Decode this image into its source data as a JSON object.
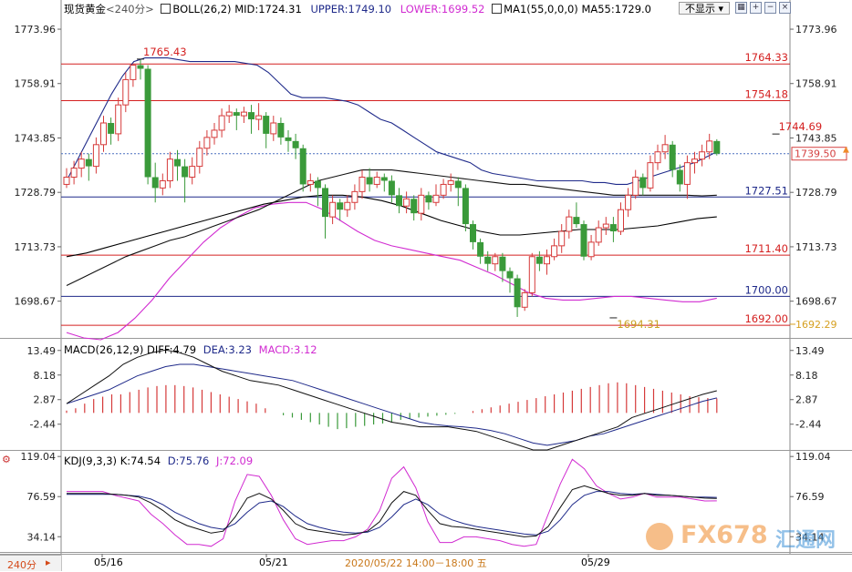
{
  "header": {
    "symbol": "现货黄金",
    "period": "240分",
    "boll": "BOLL(26,2)",
    "mid": "MID:1724.31",
    "upper": "UPPER:1749.10",
    "lower": "LOWER:1699.52",
    "ma": "MA1(55,0,0,0)",
    "ma55": "MA55:1729.0",
    "hide_button": "不显示",
    "tool_icons": [
      "grid-icon",
      "plus-icon",
      "minus-icon",
      "close-icon"
    ]
  },
  "macd_header": {
    "title": "MACD(26,12,9)",
    "diff": "DIFF:4.79",
    "dea": "DEA:3.23",
    "macd": "MACD:3.12"
  },
  "kdj_header": {
    "title": "KDJ(9,3,3)",
    "k": "K:74.54",
    "d": "D:75.76",
    "j": "J:72.09"
  },
  "bottom": {
    "period_label": "240分",
    "x_ticks": [
      "05/16",
      "05/21",
      "05/29"
    ],
    "cursor_time": "2020/05/22 14:00－18:00 五"
  },
  "watermark": {
    "brand": "FX678",
    "cn": "汇通网"
  },
  "colors": {
    "up": "#d63a3a",
    "down": "#3a9a3a",
    "mid": "#000000",
    "upper": "#1f2a8a",
    "lower": "#d12bd1",
    "ma55": "#111111",
    "hline_red": "#d42020",
    "hline_blue": "#1f2a8a",
    "current": "#4a6fbf",
    "price_tag": "#d44040"
  },
  "chart_data": [
    {
      "type": "candlestick",
      "title": "现货黄金 240分",
      "ylim": [
        1688.5,
        1777.5
      ],
      "y_ticks": [
        "1773.96",
        "1758.91",
        "1743.85",
        "1728.79",
        "1713.73",
        "1698.67"
      ],
      "current_price": "1739.50",
      "current_value": 1739.5,
      "lower_price_label": "1692.29",
      "lower_price_value": 1692.29,
      "annotations": [
        {
          "text": "1765.43",
          "index": 10,
          "value": 1765.43,
          "type": "high"
        },
        {
          "text": "1694.31",
          "index": 74,
          "value": 1694.31,
          "type": "low"
        },
        {
          "text": "1744.69",
          "index": 96,
          "value": 1744.69,
          "type": "high"
        }
      ],
      "horizontal_lines": [
        {
          "label": "1764.33",
          "value": 1764.33,
          "color": "red"
        },
        {
          "label": "1754.18",
          "value": 1754.18,
          "color": "red"
        },
        {
          "label": "1727.51",
          "value": 1727.51,
          "color": "blue"
        },
        {
          "label": "1711.40",
          "value": 1711.4,
          "color": "red"
        },
        {
          "label": "1700.00",
          "value": 1700.0,
          "color": "blue"
        },
        {
          "label": "1692.00",
          "value": 1692.0,
          "color": "red"
        }
      ],
      "candles": [
        [
          1731.0,
          1733.0,
          1735.5,
          1730.0
        ],
        [
          1733.0,
          1735.5,
          1737.5,
          1731.0
        ],
        [
          1735.5,
          1738.0,
          1740.0,
          1733.0
        ],
        [
          1738.0,
          1736.0,
          1739.5,
          1732.0
        ],
        [
          1736.0,
          1742.0,
          1744.0,
          1734.0
        ],
        [
          1742.0,
          1748.0,
          1750.0,
          1740.0
        ],
        [
          1748.0,
          1745.0,
          1749.5,
          1742.0
        ],
        [
          1745.0,
          1753.0,
          1755.0,
          1743.0
        ],
        [
          1753.0,
          1760.0,
          1762.0,
          1751.0
        ],
        [
          1760.0,
          1764.0,
          1764.5,
          1758.0
        ],
        [
          1764.0,
          1763.0,
          1765.43,
          1760.0
        ],
        [
          1763.0,
          1733.0,
          1764.0,
          1731.0
        ],
        [
          1733.0,
          1730.0,
          1737.0,
          1726.0
        ],
        [
          1730.0,
          1732.0,
          1734.0,
          1728.0
        ],
        [
          1732.0,
          1738.0,
          1740.0,
          1730.0
        ],
        [
          1738.0,
          1736.0,
          1740.5,
          1732.0
        ],
        [
          1736.0,
          1733.0,
          1738.0,
          1726.0
        ],
        [
          1733.0,
          1736.0,
          1738.5,
          1731.0
        ],
        [
          1736.0,
          1741.0,
          1743.0,
          1734.0
        ],
        [
          1741.0,
          1744.0,
          1746.0,
          1739.0
        ],
        [
          1744.0,
          1746.0,
          1748.0,
          1742.0
        ],
        [
          1746.0,
          1750.0,
          1752.0,
          1744.0
        ],
        [
          1750.0,
          1751.0,
          1753.0,
          1748.0
        ],
        [
          1751.0,
          1750.0,
          1752.0,
          1746.0
        ],
        [
          1750.0,
          1751.0,
          1752.5,
          1748.0
        ],
        [
          1751.0,
          1749.0,
          1753.0,
          1745.0
        ],
        [
          1749.0,
          1750.0,
          1753.5,
          1746.0
        ],
        [
          1750.0,
          1745.0,
          1751.0,
          1741.0
        ],
        [
          1745.0,
          1748.0,
          1750.0,
          1743.0
        ],
        [
          1748.0,
          1744.0,
          1749.5,
          1742.0
        ],
        [
          1744.0,
          1743.0,
          1746.0,
          1740.0
        ],
        [
          1743.0,
          1741.0,
          1745.0,
          1738.0
        ],
        [
          1741.0,
          1731.0,
          1742.0,
          1729.0
        ],
        [
          1731.0,
          1732.0,
          1734.0,
          1729.0
        ],
        [
          1732.0,
          1730.0,
          1733.0,
          1725.0
        ],
        [
          1730.0,
          1722.0,
          1731.0,
          1716.0
        ],
        [
          1722.0,
          1726.0,
          1728.0,
          1720.0
        ],
        [
          1726.0,
          1724.0,
          1727.0,
          1721.0
        ],
        [
          1724.0,
          1726.0,
          1728.0,
          1722.0
        ],
        [
          1726.0,
          1729.0,
          1731.0,
          1724.0
        ],
        [
          1729.0,
          1733.0,
          1735.0,
          1727.0
        ],
        [
          1733.0,
          1731.0,
          1735.5,
          1729.0
        ],
        [
          1731.0,
          1733.0,
          1734.5,
          1730.0
        ],
        [
          1733.0,
          1732.0,
          1734.0,
          1729.0
        ],
        [
          1732.0,
          1728.0,
          1733.5,
          1726.0
        ],
        [
          1728.0,
          1725.0,
          1730.0,
          1723.0
        ],
        [
          1725.0,
          1727.0,
          1729.0,
          1723.0
        ],
        [
          1727.0,
          1723.0,
          1728.0,
          1721.0
        ],
        [
          1723.0,
          1728.0,
          1730.0,
          1721.0
        ],
        [
          1728.0,
          1726.0,
          1729.0,
          1724.0
        ],
        [
          1726.0,
          1728.0,
          1731.0,
          1725.0
        ],
        [
          1728.0,
          1731.0,
          1732.5,
          1727.0
        ],
        [
          1731.0,
          1732.0,
          1734.0,
          1729.0
        ],
        [
          1732.0,
          1730.0,
          1733.0,
          1725.0
        ],
        [
          1730.0,
          1720.0,
          1731.0,
          1718.0
        ],
        [
          1720.0,
          1715.0,
          1721.0,
          1713.0
        ],
        [
          1715.0,
          1711.0,
          1716.0,
          1709.0
        ],
        [
          1711.0,
          1709.0,
          1712.5,
          1707.0
        ],
        [
          1709.0,
          1711.0,
          1712.0,
          1707.0
        ],
        [
          1711.0,
          1707.0,
          1712.0,
          1704.0
        ],
        [
          1707.0,
          1705.0,
          1708.0,
          1701.0
        ],
        [
          1705.0,
          1697.0,
          1706.0,
          1694.31
        ],
        [
          1697.0,
          1701.0,
          1702.0,
          1696.0
        ],
        [
          1701.0,
          1711.0,
          1712.0,
          1700.0
        ],
        [
          1711.0,
          1709.0,
          1712.5,
          1707.0
        ],
        [
          1709.0,
          1711.0,
          1713.0,
          1706.0
        ],
        [
          1711.0,
          1714.0,
          1716.0,
          1710.0
        ],
        [
          1714.0,
          1718.0,
          1720.0,
          1712.0
        ],
        [
          1718.0,
          1722.0,
          1724.0,
          1716.0
        ],
        [
          1722.0,
          1720.0,
          1726.0,
          1719.0
        ],
        [
          1720.0,
          1711.0,
          1721.0,
          1710.0
        ],
        [
          1711.0,
          1715.0,
          1717.0,
          1710.0
        ],
        [
          1715.0,
          1719.0,
          1721.0,
          1714.0
        ],
        [
          1719.0,
          1720.0,
          1722.0,
          1717.0
        ],
        [
          1720.0,
          1718.0,
          1722.0,
          1715.0
        ],
        [
          1718.0,
          1724.0,
          1726.0,
          1717.0
        ],
        [
          1724.0,
          1728.0,
          1730.0,
          1722.0
        ],
        [
          1728.0,
          1733.0,
          1735.0,
          1727.0
        ],
        [
          1733.0,
          1730.0,
          1734.0,
          1728.0
        ],
        [
          1730.0,
          1737.0,
          1739.0,
          1729.0
        ],
        [
          1737.0,
          1740.0,
          1742.0,
          1735.0
        ],
        [
          1740.0,
          1742.0,
          1744.69,
          1738.0
        ],
        [
          1742.0,
          1735.0,
          1743.0,
          1733.0
        ],
        [
          1735.0,
          1731.0,
          1736.5,
          1729.0
        ],
        [
          1731.0,
          1737.0,
          1739.0,
          1727.0
        ],
        [
          1737.0,
          1738.0,
          1740.0,
          1734.0
        ],
        [
          1738.0,
          1740.0,
          1742.0,
          1736.0
        ],
        [
          1740.0,
          1743.0,
          1745.0,
          1738.0
        ],
        [
          1743.0,
          1739.5,
          1743.5,
          1739.0
        ]
      ],
      "boll_upper": [
        1732,
        1738,
        1744,
        1750,
        1756,
        1761,
        1765,
        1766,
        1766,
        1766,
        1765.5,
        1765,
        1765,
        1765,
        1765,
        1765,
        1764.5,
        1764,
        1762,
        1759,
        1756,
        1755,
        1755,
        1755,
        1754.5,
        1754,
        1753,
        1751,
        1749,
        1748,
        1746,
        1744,
        1742,
        1740,
        1739,
        1738,
        1737,
        1735,
        1734,
        1733.5,
        1733,
        1732.5,
        1732,
        1732,
        1732,
        1732,
        1732,
        1731.5,
        1731.5,
        1731,
        1731,
        1732,
        1733,
        1734,
        1735,
        1736,
        1737,
        1738.5,
        1740
      ],
      "boll_mid": [
        1711,
        1712,
        1713.5,
        1715,
        1716.5,
        1718,
        1719.5,
        1721,
        1722.5,
        1724,
        1725.5,
        1726.5,
        1727.5,
        1728,
        1728,
        1727.5,
        1726.5,
        1725,
        1723,
        1721,
        1719.5,
        1718,
        1717,
        1717,
        1717.5,
        1718,
        1718.5,
        1718.5,
        1718.5,
        1719,
        1719.5,
        1720.5,
        1721.5,
        1722
      ],
      "boll_lower": [
        1690,
        1688.5,
        1688,
        1690,
        1694,
        1699,
        1705,
        1710,
        1715,
        1719,
        1722,
        1724.5,
        1725.5,
        1726,
        1726,
        1724,
        1721,
        1718,
        1715.5,
        1714,
        1713,
        1712,
        1711,
        1710,
        1708,
        1706,
        1703.5,
        1701,
        1699.5,
        1699,
        1699,
        1699.5,
        1700,
        1700,
        1699.5,
        1699,
        1698.5,
        1698.5,
        1699.5
      ],
      "ma55": [
        1703,
        1705,
        1707,
        1709,
        1711,
        1712.5,
        1714,
        1715.5,
        1716.5,
        1718,
        1719.5,
        1721,
        1722.5,
        1724,
        1726,
        1728,
        1730,
        1732,
        1733,
        1734,
        1735,
        1735,
        1735,
        1734.5,
        1734,
        1733.5,
        1733,
        1732.5,
        1732,
        1731.5,
        1731,
        1731,
        1730.5,
        1730,
        1729.5,
        1729,
        1728.5,
        1728,
        1728,
        1728,
        1728,
        1728,
        1728,
        1727.8,
        1728
      ]
    },
    {
      "type": "bar",
      "title": "MACD(26,12,9)",
      "ylim": [
        -8,
        16
      ],
      "y_ticks": [
        "13.49",
        "8.18",
        "2.87",
        "-2.44"
      ],
      "series": [
        {
          "name": "DIFF",
          "values": [
            2,
            4,
            6,
            8,
            10.5,
            12,
            13,
            13.6,
            13,
            12,
            10.5,
            9,
            8,
            7,
            6.5,
            6,
            5,
            4,
            3,
            2,
            1,
            0,
            -1,
            -2,
            -2.5,
            -3,
            -3,
            -3,
            -3.5,
            -4,
            -5,
            -6,
            -7,
            -8,
            -8,
            -7,
            -6,
            -5,
            -4,
            -3,
            -1,
            0,
            1,
            2,
            3,
            4,
            4.79
          ]
        },
        {
          "name": "DEA",
          "values": [
            2,
            3,
            4,
            5,
            6.5,
            8,
            9,
            10,
            10.5,
            10.5,
            10,
            9.5,
            9,
            8.5,
            8,
            7.5,
            7,
            6,
            5,
            4,
            3,
            2,
            1,
            0,
            -1,
            -2,
            -2.5,
            -2.8,
            -3,
            -3.3,
            -3.8,
            -4.5,
            -5.5,
            -6.5,
            -7,
            -6.5,
            -6,
            -5,
            -4.5,
            -3.5,
            -2.5,
            -1.5,
            -0.5,
            0.5,
            1.5,
            2.5,
            3.23
          ]
        },
        {
          "name": "MACD",
          "values": [
            0.5,
            1,
            2,
            3,
            3.5,
            4,
            4,
            4.5,
            5,
            5.5,
            5.8,
            6,
            6,
            5.8,
            5.5,
            5,
            4.5,
            4,
            3.5,
            3,
            2.5,
            2,
            1,
            0,
            -0.5,
            -1,
            -1.5,
            -2,
            -2.5,
            -3,
            -3.5,
            -3.3,
            -3,
            -2.8,
            -2.5,
            -2.3,
            -2,
            -1.5,
            -1.2,
            -1,
            -0.8,
            -0.6,
            -0.4,
            -0.2,
            0,
            0.4,
            0.8,
            1.2,
            1.6,
            2,
            2.4,
            2.8,
            3.2,
            3.6,
            4,
            4.4,
            4.8,
            5.2,
            5.6,
            6,
            6.4,
            6.6,
            6.4,
            6,
            5.6,
            5.2,
            4.8,
            4.4,
            4,
            3.6,
            3.4,
            3.2,
            3.12
          ]
        }
      ]
    },
    {
      "type": "line",
      "title": "KDJ(9,3,3)",
      "ylim": [
        18,
        125
      ],
      "y_ticks": [
        "119.04",
        "76.59",
        "34.14"
      ],
      "series": [
        {
          "name": "K",
          "values": [
            80,
            80,
            80,
            80,
            79,
            78,
            76,
            70,
            62,
            52,
            46,
            42,
            38,
            40,
            55,
            75,
            80,
            74,
            62,
            48,
            42,
            40,
            38,
            36,
            37,
            40,
            50,
            70,
            82,
            78,
            62,
            48,
            45,
            44,
            42,
            40,
            38,
            36,
            34,
            35,
            45,
            65,
            84,
            88,
            84,
            80,
            78,
            78,
            80,
            78,
            78,
            77,
            76,
            75,
            74.54
          ]
        },
        {
          "name": "D",
          "values": [
            79,
            79,
            79,
            79,
            79,
            78,
            77,
            74,
            68,
            60,
            54,
            48,
            44,
            42,
            48,
            60,
            70,
            72,
            66,
            56,
            48,
            44,
            41,
            39,
            38,
            39,
            44,
            55,
            68,
            74,
            68,
            58,
            52,
            48,
            45,
            43,
            41,
            39,
            37,
            36,
            40,
            52,
            68,
            78,
            82,
            82,
            80,
            79,
            80,
            79,
            78,
            77,
            76,
            76,
            75.76
          ]
        },
        {
          "name": "J",
          "values": [
            82,
            82,
            82,
            82,
            78,
            75,
            72,
            58,
            48,
            36,
            26,
            26,
            24,
            32,
            72,
            100,
            98,
            78,
            52,
            32,
            26,
            28,
            30,
            30,
            34,
            42,
            62,
            96,
            108,
            86,
            50,
            28,
            28,
            34,
            34,
            32,
            30,
            26,
            24,
            26,
            58,
            90,
            116,
            106,
            88,
            80,
            74,
            76,
            80,
            76,
            76,
            76,
            74,
            72,
            72.09
          ]
        }
      ]
    }
  ]
}
